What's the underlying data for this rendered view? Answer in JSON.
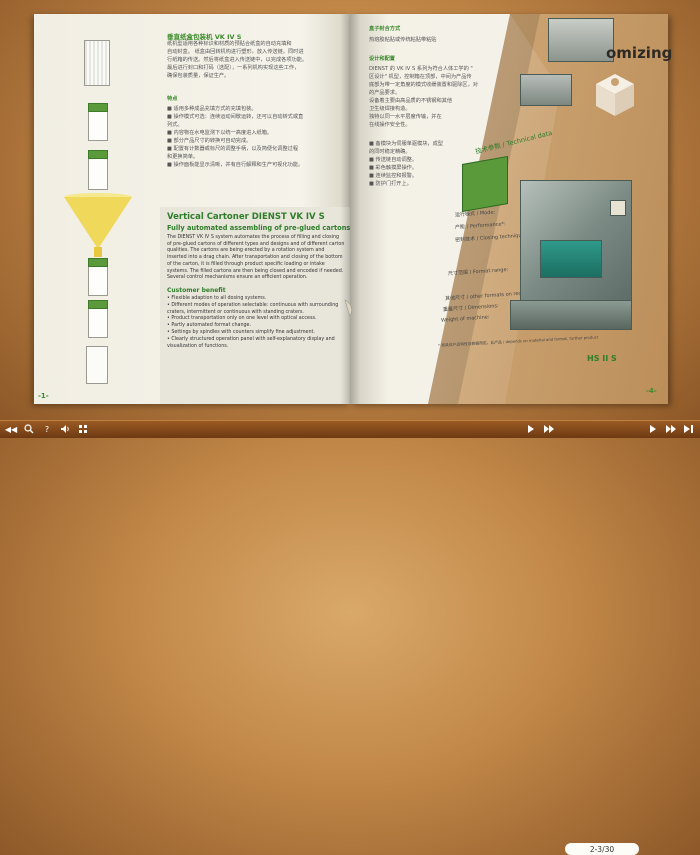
{
  "left_page": {
    "cn_title": "垂直纸盒包装机 VK IV S",
    "cn_intro": [
      "纸机型适用各种标识和材质的预贴合纸盒的自动充填和",
      "自动封盒。 纸盒由回转机构进行塑形，放入传送链。同时进",
      "行纸箱的传送。然后将纸盒进入传送链中，以完成各项功能。",
      "最后进行封口和打码（选配），一系列机构实现这些工作，",
      "确保包装质量，保证生产。"
    ],
    "cn_features_title": "特点",
    "cn_features": [
      "■ 适用多种成品充填方式的充填包装。",
      "■ 操作模式可选：连续运动间歇运转，还可以自动转式或直",
      "   列式。",
      "■ 内容物在水电监测下以统一高度进入纸箱。",
      "■ 部分产品尺寸的转换可自动完成。",
      "■ 配置有计数器或标尺的调整手柄，以及简便化调整过程",
      "   和更换简单。",
      "■ 操作面板能显示清晰，并有自行解释和生产可视化功能。"
    ],
    "en_title": "Vertical Cartoner DIENST VK IV S",
    "en_subtitle": "Fully automated assembling of pre-glued cartons.",
    "en_body": "The DIENST VK IV S system automates the process of filling and closing of pre-glued cartons of different types and designs and of different carton qualities. The cartons are being erected by a rotation system and inserted into a drag chain. After transportation and closing of the bottom of the carton, it is filled through product specific loading or intake systems. The filled cartons are then being closed and encoded if needed. Several control mechanisms ensure an efficient operation.",
    "en_benefit_title": "Customer benefit",
    "en_benefits": [
      "• Flexible adaption to all dosing systems.",
      "• Different modes of operation selectable: continuous with surrounding craters, intermittent or continuous with standing craters.",
      "• Product transportation only on one level with optical access.",
      "• Partly automated format change.",
      "• Settings by spindles with counters simplify fine adjustment.",
      "• Clearly structured operation panel with self-explanatory display and visualization of functions."
    ],
    "page_number": "-1-"
  },
  "right_page": {
    "cn_heading1": "盒子封合方式",
    "cn_line1": "热熔胶粘贴或传统粘贴带粘贴",
    "cn_heading2": "设计和配置",
    "cn_design": [
      "DIENST 的 VK IV S 系列为符合人体工学的 \"",
      "区设计\" 机型，控制箱在顶部，中间为产品传",
      "底部为带一定角度的模式收缓装置和驱除区，对",
      "的产品要求。",
      "设备着主要由高品质的不锈钢和其他",
      "卫生级焊接构造。",
      "独特以同一水平层度传输，并在",
      "在线操作安全性。"
    ],
    "cn_list": [
      "■ 备模块为伺服单驱模块，成型",
      "   的同时稳定精确。",
      "■ 传送链自动调整。",
      "■ 彩色触摸屏操作。",
      "■ 连续监控和报警。",
      "■ 防护门打开上。"
    ],
    "page_number": "-4-"
  },
  "flip_page": {
    "heading": "omizing",
    "tech_label": "技术参数 / Technical data",
    "rows": [
      "运行模式 / Mode:",
      "产能 / Performance*:",
      "密封技术 / Closing technique:",
      "尺寸范围 / Format range:",
      "其他尺寸 / other formats on request",
      "重量尺寸 / Dimensions:",
      "Weight of machine:"
    ],
    "footnote": "* 视具体产品特性及数据而定，此产品 / depends on material and format, further product",
    "model_label": "HS II S"
  },
  "toolbar": {
    "page_indicator": "2-3/30",
    "buttons": [
      "◀◀",
      "?",
      "⚲",
      "◂)",
      "⊞",
      "▶▶",
      "◀",
      "▶",
      "▶▶"
    ]
  }
}
